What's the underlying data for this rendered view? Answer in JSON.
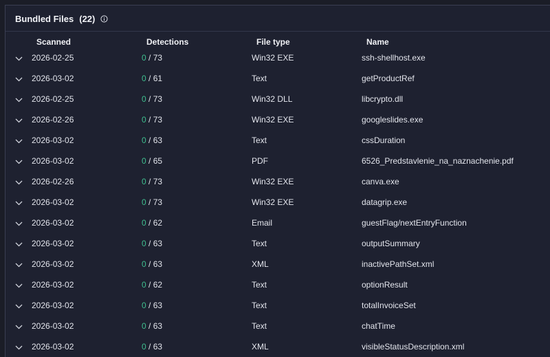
{
  "panel": {
    "title": "Bundled Files",
    "count": "(22)",
    "info_icon": "info-circle-icon"
  },
  "columns": {
    "scanned": "Scanned",
    "detections": "Detections",
    "filetype": "File type",
    "name": "Name"
  },
  "colors": {
    "background": "#1e2130",
    "clean_detection": "#3fbf8f",
    "text": "#e3e5ec"
  },
  "rows": [
    {
      "scanned": "2026-02-25",
      "positives": "0",
      "total": " / 73",
      "filetype": "Win32 EXE",
      "name": "ssh-shellhost.exe"
    },
    {
      "scanned": "2026-03-02",
      "positives": "0",
      "total": " / 61",
      "filetype": "Text",
      "name": "getProductRef"
    },
    {
      "scanned": "2026-02-25",
      "positives": "0",
      "total": " / 73",
      "filetype": "Win32 DLL",
      "name": "libcrypto.dll"
    },
    {
      "scanned": "2026-02-26",
      "positives": "0",
      "total": " / 73",
      "filetype": "Win32 EXE",
      "name": "googleslides.exe"
    },
    {
      "scanned": "2026-03-02",
      "positives": "0",
      "total": " / 63",
      "filetype": "Text",
      "name": "cssDuration"
    },
    {
      "scanned": "2026-03-02",
      "positives": "0",
      "total": " / 65",
      "filetype": "PDF",
      "name": "6526_Predstavlenie_na_naznachenie.pdf"
    },
    {
      "scanned": "2026-02-26",
      "positives": "0",
      "total": " / 73",
      "filetype": "Win32 EXE",
      "name": "canva.exe"
    },
    {
      "scanned": "2026-03-02",
      "positives": "0",
      "total": " / 73",
      "filetype": "Win32 EXE",
      "name": "datagrip.exe"
    },
    {
      "scanned": "2026-03-02",
      "positives": "0",
      "total": " / 62",
      "filetype": "Email",
      "name": "guestFlag/nextEntryFunction"
    },
    {
      "scanned": "2026-03-02",
      "positives": "0",
      "total": " / 63",
      "filetype": "Text",
      "name": "outputSummary"
    },
    {
      "scanned": "2026-03-02",
      "positives": "0",
      "total": " / 63",
      "filetype": "XML",
      "name": "inactivePathSet.xml"
    },
    {
      "scanned": "2026-03-02",
      "positives": "0",
      "total": " / 62",
      "filetype": "Text",
      "name": "optionResult"
    },
    {
      "scanned": "2026-03-02",
      "positives": "0",
      "total": " / 63",
      "filetype": "Text",
      "name": "totalInvoiceSet"
    },
    {
      "scanned": "2026-03-02",
      "positives": "0",
      "total": " / 63",
      "filetype": "Text",
      "name": "chatTime"
    },
    {
      "scanned": "2026-03-02",
      "positives": "0",
      "total": " / 63",
      "filetype": "XML",
      "name": "visibleStatusDescription.xml"
    }
  ]
}
